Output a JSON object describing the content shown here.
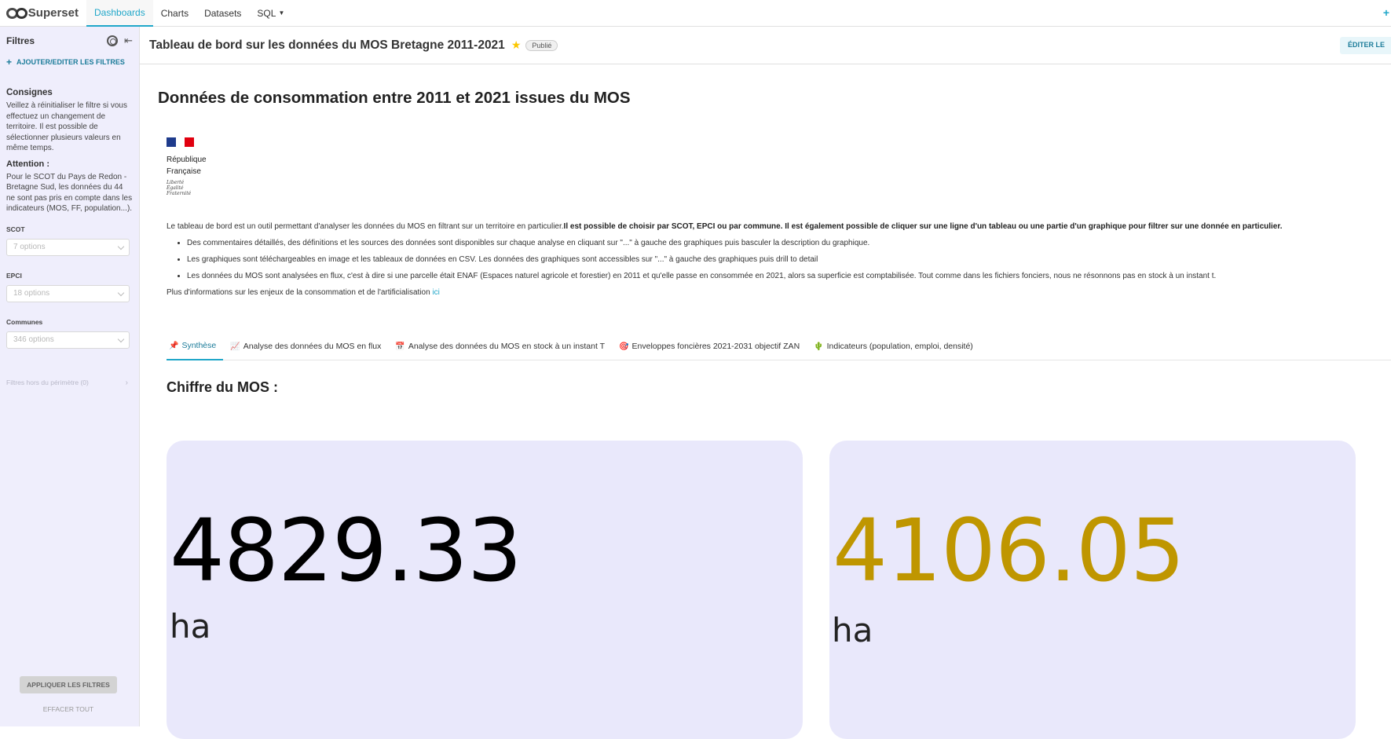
{
  "nav": {
    "brand": "Superset",
    "items": [
      "Dashboards",
      "Charts",
      "Datasets",
      "SQL"
    ],
    "plus": "+"
  },
  "sidebar": {
    "title": "Filtres",
    "add_filters": "AJOUTER/EDITER LES FILTRES",
    "consignes_title": "Consignes",
    "consignes_text": "Veillez à réinitialiser le filtre si vous effectuez un changement de territoire. Il est possible de sélectionner plusieurs valeurs en même temps.",
    "attention_title": "Attention :",
    "attention_text": "Pour le SCOT du Pays de Redon - Bretagne Sud, les données du 44 ne sont pas pris en compte dans les indicateurs (MOS, FF, population...).",
    "filters": [
      {
        "label": "SCOT",
        "placeholder": "7 options"
      },
      {
        "label": "EPCI",
        "placeholder": "18 options"
      },
      {
        "label": "Communes",
        "placeholder": "346 options"
      }
    ],
    "out_of_scope": "Filtres hors du périmètre (0)",
    "apply": "APPLIQUER LES FILTRES",
    "clear": "EFFACER TOUT"
  },
  "header": {
    "title": "Tableau de bord sur les données du MOS Bretagne 2011-2021",
    "badge": "Publié",
    "edit": "ÉDITER LE"
  },
  "main": {
    "heading": "Données de consommation entre 2011 et 2021 issues du MOS",
    "rf_line1": "République",
    "rf_line2": "Française",
    "devise1": "Liberté",
    "devise2": "Égalité",
    "devise3": "Fraternité",
    "intro_plain": "Le tableau de bord est un outil permettant d'analyser les données du MOS en filtrant sur un territoire en particulier.",
    "intro_bold": "Il est possible de choisir par SCOT, EPCI ou par commune. Il est également possible de cliquer sur une ligne d'un tableau ou une partie d'un graphique pour filtrer sur une donnée en particulier.",
    "bullets": [
      "Des commentaires détaillés, des définitions et les sources des données sont disponibles sur chaque analyse en cliquant sur \"...\" à gauche des graphiques puis basculer la description du graphique.",
      "Les graphiques sont téléchargeables en image et les tableaux de données en CSV. Les données des graphiques sont accessibles sur \"...\" à gauche des graphiques puis drill to detail",
      "Les données du MOS sont analysées en flux, c'est à dire si une parcelle était ENAF (Espaces naturel agricole et forestier) en 2011 et qu'elle passe en consommée en 2021, alors sa superficie est comptabilisée. Tout comme dans les fichiers fonciers, nous ne résonnons pas en stock à un instant t."
    ],
    "more_info": "Plus d'informations sur les enjeux de la consommation et de l'artificialisation ",
    "more_link": "ici",
    "tabs": [
      {
        "icon": "📌",
        "label": "Synthèse"
      },
      {
        "icon": "📈",
        "label": "Analyse des données du MOS en flux"
      },
      {
        "icon": "📅",
        "label": "Analyse des données du MOS en stock à un instant T"
      },
      {
        "icon": "🎯",
        "label": "Enveloppes foncières 2021-2031 objectif ZAN"
      },
      {
        "icon": "🌵",
        "label": "Indicateurs (population, emploi, densité)"
      }
    ],
    "section_title": "Chiffre du MOS :",
    "cards": [
      {
        "value": "4829.33",
        "unit": "ha",
        "color": "#000000"
      },
      {
        "value": "4106.05",
        "unit": "ha",
        "color": "#bf9600"
      }
    ]
  },
  "colors": {
    "accent": "#20a7c9",
    "sidebar_bg": "#efeefc",
    "card_bg": "#e9e8fb"
  }
}
